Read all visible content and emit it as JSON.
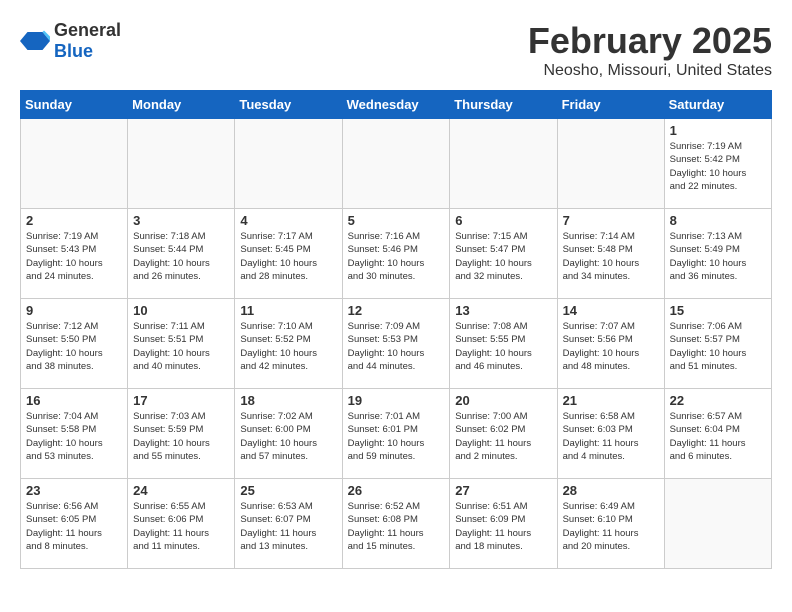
{
  "header": {
    "logo_general": "General",
    "logo_blue": "Blue",
    "month": "February 2025",
    "location": "Neosho, Missouri, United States"
  },
  "weekdays": [
    "Sunday",
    "Monday",
    "Tuesday",
    "Wednesday",
    "Thursday",
    "Friday",
    "Saturday"
  ],
  "weeks": [
    [
      {
        "day": "",
        "info": ""
      },
      {
        "day": "",
        "info": ""
      },
      {
        "day": "",
        "info": ""
      },
      {
        "day": "",
        "info": ""
      },
      {
        "day": "",
        "info": ""
      },
      {
        "day": "",
        "info": ""
      },
      {
        "day": "1",
        "info": "Sunrise: 7:19 AM\nSunset: 5:42 PM\nDaylight: 10 hours\nand 22 minutes."
      }
    ],
    [
      {
        "day": "2",
        "info": "Sunrise: 7:19 AM\nSunset: 5:43 PM\nDaylight: 10 hours\nand 24 minutes."
      },
      {
        "day": "3",
        "info": "Sunrise: 7:18 AM\nSunset: 5:44 PM\nDaylight: 10 hours\nand 26 minutes."
      },
      {
        "day": "4",
        "info": "Sunrise: 7:17 AM\nSunset: 5:45 PM\nDaylight: 10 hours\nand 28 minutes."
      },
      {
        "day": "5",
        "info": "Sunrise: 7:16 AM\nSunset: 5:46 PM\nDaylight: 10 hours\nand 30 minutes."
      },
      {
        "day": "6",
        "info": "Sunrise: 7:15 AM\nSunset: 5:47 PM\nDaylight: 10 hours\nand 32 minutes."
      },
      {
        "day": "7",
        "info": "Sunrise: 7:14 AM\nSunset: 5:48 PM\nDaylight: 10 hours\nand 34 minutes."
      },
      {
        "day": "8",
        "info": "Sunrise: 7:13 AM\nSunset: 5:49 PM\nDaylight: 10 hours\nand 36 minutes."
      }
    ],
    [
      {
        "day": "9",
        "info": "Sunrise: 7:12 AM\nSunset: 5:50 PM\nDaylight: 10 hours\nand 38 minutes."
      },
      {
        "day": "10",
        "info": "Sunrise: 7:11 AM\nSunset: 5:51 PM\nDaylight: 10 hours\nand 40 minutes."
      },
      {
        "day": "11",
        "info": "Sunrise: 7:10 AM\nSunset: 5:52 PM\nDaylight: 10 hours\nand 42 minutes."
      },
      {
        "day": "12",
        "info": "Sunrise: 7:09 AM\nSunset: 5:53 PM\nDaylight: 10 hours\nand 44 minutes."
      },
      {
        "day": "13",
        "info": "Sunrise: 7:08 AM\nSunset: 5:55 PM\nDaylight: 10 hours\nand 46 minutes."
      },
      {
        "day": "14",
        "info": "Sunrise: 7:07 AM\nSunset: 5:56 PM\nDaylight: 10 hours\nand 48 minutes."
      },
      {
        "day": "15",
        "info": "Sunrise: 7:06 AM\nSunset: 5:57 PM\nDaylight: 10 hours\nand 51 minutes."
      }
    ],
    [
      {
        "day": "16",
        "info": "Sunrise: 7:04 AM\nSunset: 5:58 PM\nDaylight: 10 hours\nand 53 minutes."
      },
      {
        "day": "17",
        "info": "Sunrise: 7:03 AM\nSunset: 5:59 PM\nDaylight: 10 hours\nand 55 minutes."
      },
      {
        "day": "18",
        "info": "Sunrise: 7:02 AM\nSunset: 6:00 PM\nDaylight: 10 hours\nand 57 minutes."
      },
      {
        "day": "19",
        "info": "Sunrise: 7:01 AM\nSunset: 6:01 PM\nDaylight: 10 hours\nand 59 minutes."
      },
      {
        "day": "20",
        "info": "Sunrise: 7:00 AM\nSunset: 6:02 PM\nDaylight: 11 hours\nand 2 minutes."
      },
      {
        "day": "21",
        "info": "Sunrise: 6:58 AM\nSunset: 6:03 PM\nDaylight: 11 hours\nand 4 minutes."
      },
      {
        "day": "22",
        "info": "Sunrise: 6:57 AM\nSunset: 6:04 PM\nDaylight: 11 hours\nand 6 minutes."
      }
    ],
    [
      {
        "day": "23",
        "info": "Sunrise: 6:56 AM\nSunset: 6:05 PM\nDaylight: 11 hours\nand 8 minutes."
      },
      {
        "day": "24",
        "info": "Sunrise: 6:55 AM\nSunset: 6:06 PM\nDaylight: 11 hours\nand 11 minutes."
      },
      {
        "day": "25",
        "info": "Sunrise: 6:53 AM\nSunset: 6:07 PM\nDaylight: 11 hours\nand 13 minutes."
      },
      {
        "day": "26",
        "info": "Sunrise: 6:52 AM\nSunset: 6:08 PM\nDaylight: 11 hours\nand 15 minutes."
      },
      {
        "day": "27",
        "info": "Sunrise: 6:51 AM\nSunset: 6:09 PM\nDaylight: 11 hours\nand 18 minutes."
      },
      {
        "day": "28",
        "info": "Sunrise: 6:49 AM\nSunset: 6:10 PM\nDaylight: 11 hours\nand 20 minutes."
      },
      {
        "day": "",
        "info": ""
      }
    ]
  ]
}
